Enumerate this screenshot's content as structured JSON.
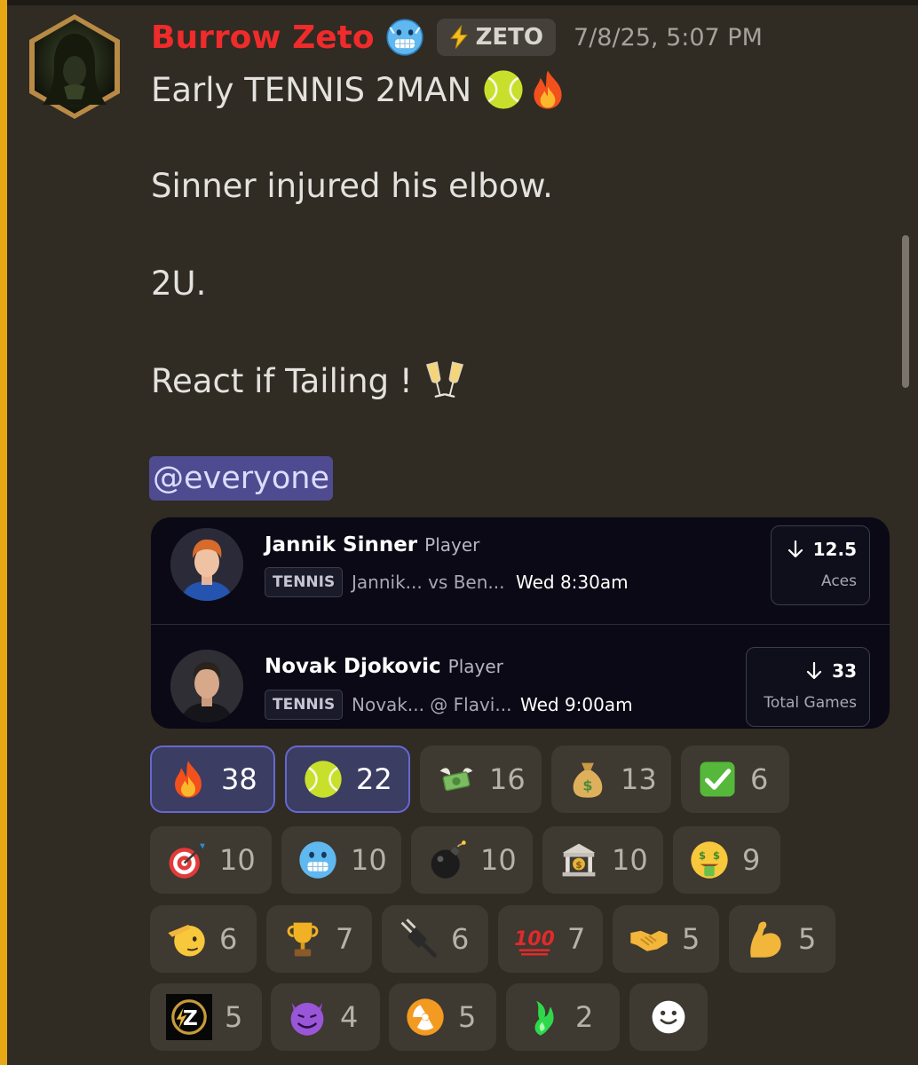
{
  "message": {
    "author": "Burrow Zeto",
    "author_color": "#ef2b2b",
    "author_emoji": "cold-face-icon",
    "tag": "ZETO",
    "tag_icon": "lightning-icon",
    "timestamp": "7/8/25, 5:07 PM",
    "lines": [
      {
        "text": "Early TENNIS 2MAN",
        "icons": [
          "tennis-ball-icon",
          "fire-icon"
        ]
      },
      {
        "text": "Sinner injured his elbow."
      },
      {
        "text": "2U."
      },
      {
        "text": "React if Tailing !",
        "icons": [
          "clinking-glasses-icon"
        ]
      }
    ],
    "mention": "@everyone"
  },
  "embed": {
    "picks": [
      {
        "player": "Jannik Sinner",
        "role": "Player",
        "sport": "TENNIS",
        "matchup": "Jannik... vs Ben...",
        "time": "Wed 8:30am",
        "direction": "under",
        "line": "12.5",
        "stat": "Aces"
      },
      {
        "player": "Novak Djokovic",
        "role": "Player",
        "sport": "TENNIS",
        "matchup": "Novak... @ Flavi...",
        "time": "Wed 9:00am",
        "direction": "under",
        "line": "33",
        "stat": "Total Games"
      }
    ]
  },
  "reactions": [
    {
      "icon": "fire-icon",
      "count": "38",
      "active": true
    },
    {
      "icon": "tennis-ball-icon",
      "count": "22",
      "active": true
    },
    {
      "icon": "money-with-wings-icon",
      "count": "16",
      "active": false
    },
    {
      "icon": "money-bag-icon",
      "count": "13",
      "active": false
    },
    {
      "icon": "check-mark-icon",
      "count": "6",
      "active": false
    },
    {
      "icon": "direct-hit-icon",
      "count": "10",
      "active": false
    },
    {
      "icon": "cold-face-icon",
      "count": "10",
      "active": false
    },
    {
      "icon": "bomb-icon",
      "count": "10",
      "active": false
    },
    {
      "icon": "bank-icon",
      "count": "10",
      "active": false
    },
    {
      "icon": "money-mouth-face-icon",
      "count": "9",
      "active": false
    },
    {
      "icon": "saluting-face-icon",
      "count": "6",
      "active": false
    },
    {
      "icon": "trophy-icon",
      "count": "7",
      "active": false
    },
    {
      "icon": "electric-plug-icon",
      "count": "6",
      "active": false
    },
    {
      "icon": "hundred-points-icon",
      "count": "7",
      "active": false
    },
    {
      "icon": "handshake-icon",
      "count": "5",
      "active": false
    },
    {
      "icon": "flexed-biceps-icon",
      "count": "5",
      "active": false
    },
    {
      "icon": "zeto-logo-icon",
      "count": "5",
      "active": false
    },
    {
      "icon": "smiling-devil-icon",
      "count": "4",
      "active": false
    },
    {
      "icon": "radioactive-icon",
      "count": "5",
      "active": false
    },
    {
      "icon": "green-flame-icon",
      "count": "2",
      "active": false
    }
  ],
  "add_reaction_icon": "add-reaction-icon",
  "colors": {
    "background": "#302b23",
    "mention_bar": "#e8a814",
    "active_reaction": "#3b3d63",
    "active_border": "#6668d0",
    "embed_bg": "#0a0915"
  }
}
